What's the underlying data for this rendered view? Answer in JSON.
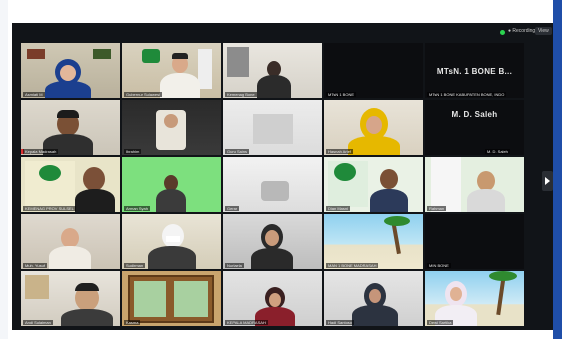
{
  "topbar": {
    "recording_label": "● Recording",
    "view_label": "View"
  },
  "participants": [
    {
      "name": "Asmiati M",
      "featured": true
    },
    {
      "name": "Gubernur Sulawesi",
      "featured": false
    },
    {
      "name": "Kemenag Bone",
      "featured": false
    },
    {
      "name": "MTsN 1 BONE",
      "featured": false
    },
    {
      "name": "MTsN. 1 BONE B...",
      "featured": false,
      "display_text": "MTsN. 1 BONE B...",
      "label": "MTsN 1 BONE KABUPATEN BONE, INDO"
    },
    {
      "name": "Kepala Madrasah",
      "featured": false
    },
    {
      "name": "Ibrahim",
      "featured": false
    },
    {
      "name": "Guru Sains",
      "featured": false
    },
    {
      "name": "Hasnah Arief",
      "featured": false
    },
    {
      "name": "M. D. Saleh",
      "featured": false,
      "display_text": "M. D. Saleh",
      "label": "M. D. Saleh"
    },
    {
      "name": "KEMENAG PROV SULSEL",
      "featured": false
    },
    {
      "name": "Arman Syah",
      "featured": false
    },
    {
      "name": "Gerar",
      "featured": false
    },
    {
      "name": "Dian Masni",
      "featured": false
    },
    {
      "name": "Rahman",
      "featured": false
    },
    {
      "name": "Muh. Yusuf",
      "featured": false
    },
    {
      "name": "Sudirman",
      "featured": false
    },
    {
      "name": "Nurlaela",
      "featured": false
    },
    {
      "name": "MAN 1 BONE MADRASAH",
      "featured": false
    },
    {
      "name": "MIN BONE",
      "featured": false
    },
    {
      "name": "Andi Sulaiman",
      "featured": false
    },
    {
      "name": "Kasma",
      "featured": false
    },
    {
      "name": "KEPALA MADRASAH",
      "featured": false
    },
    {
      "name": "Hadi Santoso",
      "featured": false
    },
    {
      "name": "Dewi Sartika",
      "featured": false
    }
  ]
}
